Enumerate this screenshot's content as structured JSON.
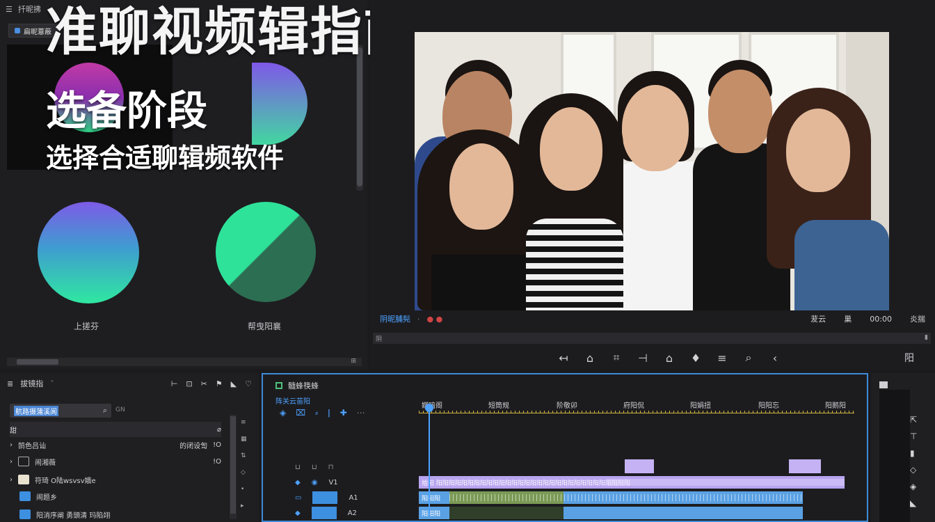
{
  "overlay": {
    "title": "准聊视频辑指南",
    "subtitle": "选备阶段",
    "subtitle2": "选择合适聊辑频软件"
  },
  "left_panel": {
    "top_label": "扦昵拂",
    "tab_label": "扁昵薏蔽",
    "clips": [
      {
        "label": "上搓芬"
      },
      {
        "label": "帮曳阳襄"
      }
    ],
    "scroll_label": "▪"
  },
  "monitor": {
    "timecode_left": "阴昵脯髡",
    "timecode_right": "00:00",
    "status_left": "茇云",
    "status_mid": "巢",
    "status_right": "炎揣",
    "ruler_label": "阴",
    "transport_icons": [
      "mark-in-icon",
      "mark-out-icon",
      "go-to-in-icon",
      "step-back-icon",
      "play-icon",
      "step-forward-icon",
      "insert-icon",
      "overwrite-icon",
      "zoom-icon"
    ],
    "export_label": "阳"
  },
  "project": {
    "title": "拔镜指",
    "search_value": "航路摄蒲溪阆",
    "search_suffix": "GN",
    "filter_label": "甜",
    "rows": [
      {
        "label": "鹄色吕讪",
        "right": "的闭设訇",
        "extra": "!O"
      },
      {
        "label": "闹湘薇",
        "right": "",
        "extra": "!O"
      },
      {
        "label": "符琦 O陆wsvsv娥e",
        "right": "",
        "extra": ""
      },
      {
        "label": "闹题乡",
        "right": "",
        "extra": ""
      },
      {
        "label": "阳消序阐 勇頭清 玛陷翊",
        "right": "",
        "extra": ""
      }
    ]
  },
  "timeline": {
    "title": "髓蜂筷蜂",
    "timecode": "阵关云苗阳",
    "ruler_labels": [
      "婀暗阁",
      "短筒规",
      "阶敬卯",
      "府阳侃",
      "阳娟扭",
      "阳阳忘",
      "阳鹅阳"
    ],
    "tracks": [
      {
        "name": "V1"
      },
      {
        "name": "A1"
      },
      {
        "name": "A2"
      }
    ],
    "clips": {
      "v1": "拾阳 阳阳阳阳阳阳阳阳阳阳阳阳阳阳阳阳阳阳阳阳阳阳阳阳阳阳阳阳阳阳阳",
      "a1": "阳阳阳",
      "a2": "阳阳阳"
    }
  },
  "colors": {
    "accent": "#4ea2ff",
    "timeline_border": "#3f8bd8",
    "violet_clip": "#b8a4ef",
    "blue_clip": "#5aa1e4",
    "green_clip": "#7a9a55"
  }
}
